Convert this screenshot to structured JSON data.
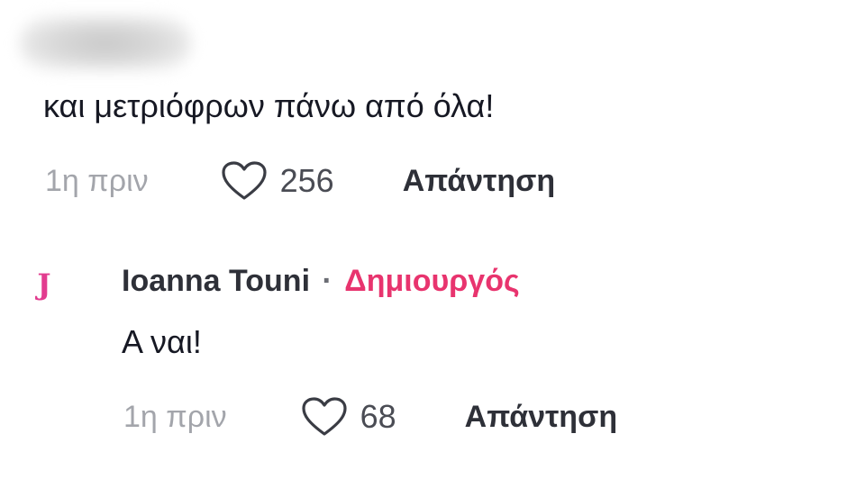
{
  "comments": [
    {
      "text": "και μετριόφρων πάνω από όλα!",
      "time": "1η πριν",
      "likes": "256",
      "reply_label": "Απάντηση"
    },
    {
      "avatar_letter": "J",
      "author": "Ioanna Touni",
      "separator": "·",
      "badge": "Δημιουργός",
      "text": "Α ναι!",
      "time": "1η πριν",
      "likes": "68",
      "reply_label": "Απάντηση"
    }
  ],
  "colors": {
    "creator_badge": "#e8346e",
    "avatar_letter": "#e23c8f",
    "muted_text": "#a3a5ab"
  },
  "icons": {
    "like": "heart-outline-icon"
  }
}
